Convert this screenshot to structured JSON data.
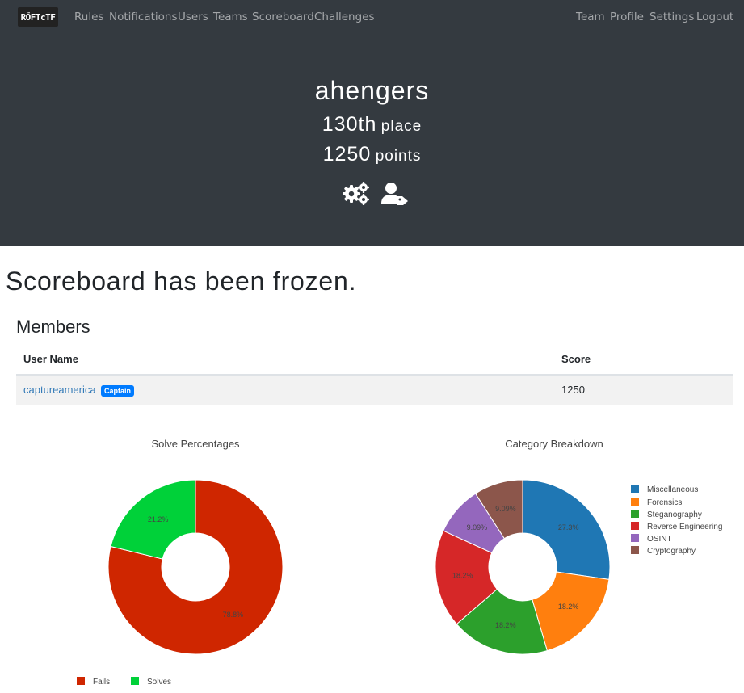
{
  "nav": {
    "logo": "RÖFTcTF",
    "left_links": [
      "Rules",
      "Notifications",
      "Users",
      "Teams",
      "Scoreboard",
      "Challenges"
    ],
    "right_links": [
      "Team",
      "Profile",
      "Settings",
      "Logout"
    ]
  },
  "team": {
    "name": "ahengers",
    "place_value": "130th",
    "place_label": "place",
    "points_value": "1250",
    "points_label": "points",
    "icons": [
      "settings-icon",
      "user-tag-icon"
    ]
  },
  "frozen_message": "Scoreboard has been frozen.",
  "members": {
    "title": "Members",
    "columns": [
      "User Name",
      "Score"
    ],
    "rows": [
      {
        "name": "captureamerica",
        "badge": "Captain",
        "score": "1250"
      }
    ]
  },
  "colors": {
    "navbar_bg": "#343a40",
    "link": "#337ab7",
    "badge": "#007bff"
  },
  "chart_data": [
    {
      "type": "pie",
      "title": "Solve Percentages",
      "labels": [
        "Fails",
        "Solves"
      ],
      "values": [
        78.8,
        21.2
      ],
      "colors": [
        "#cf2600",
        "#00d139"
      ],
      "legend": "bottom"
    },
    {
      "type": "pie",
      "title": "Category Breakdown",
      "labels": [
        "Miscellaneous",
        "Forensics",
        "Steganography",
        "Reverse Engineering",
        "OSINT",
        "Cryptography"
      ],
      "values": [
        27.3,
        18.2,
        18.2,
        18.2,
        9.09,
        9.09
      ],
      "colors": [
        "#1f77b4",
        "#ff7f0e",
        "#2ca02c",
        "#d62728",
        "#9467bd",
        "#8c564b"
      ],
      "legend": "right"
    }
  ]
}
